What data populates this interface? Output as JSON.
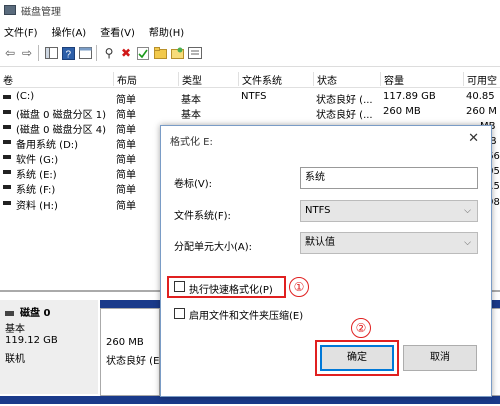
{
  "window": {
    "title": "磁盘管理"
  },
  "menu": [
    "文件(F)",
    "操作(A)",
    "查看(V)",
    "帮助(H)"
  ],
  "columns": [
    "卷",
    "布局",
    "类型",
    "文件系统",
    "状态",
    "容量",
    "可用空"
  ],
  "volumes": [
    {
      "name": "(C:)",
      "layout": "简单",
      "type": "基本",
      "fs": "NTFS",
      "status": "状态良好 (...",
      "capacity": "117.89 GB",
      "free": "40.85"
    },
    {
      "name": "(磁盘 0 磁盘分区 1)",
      "layout": "简单",
      "type": "基本",
      "fs": "",
      "status": "状态良好 (...",
      "capacity": "260 MB",
      "free": "260 M"
    },
    {
      "name": "(磁盘 0 磁盘分区 4)",
      "layout": "简单",
      "type": "",
      "fs": "",
      "status": "",
      "capacity": "",
      "free": "MB"
    },
    {
      "name": "备用系统 (D:)",
      "layout": "简单",
      "type": "",
      "fs": "",
      "status": "",
      "capacity": "",
      "free": "GB"
    },
    {
      "name": "软件 (G:)",
      "layout": "简单",
      "type": "",
      "fs": "",
      "status": "",
      "capacity": "",
      "free": ".66"
    },
    {
      "name": "系统 (E:)",
      "layout": "简单",
      "type": "",
      "fs": "",
      "status": "",
      "capacity": "",
      "free": ".05"
    },
    {
      "name": "系统 (F:)",
      "layout": "简单",
      "type": "",
      "fs": "",
      "status": "",
      "capacity": "",
      "free": "8.5"
    },
    {
      "name": "资料 (H:)",
      "layout": "简单",
      "type": "",
      "fs": "",
      "status": "",
      "capacity": "",
      "free": ".98"
    }
  ],
  "disk": {
    "name": "磁盘 0",
    "type": "基本",
    "size": "119.12 GB",
    "state": "联机"
  },
  "partition": {
    "size": "260 MB",
    "status": "状态良好 (E"
  },
  "dialog": {
    "title": "格式化 E:",
    "label_volume": "卷标(V):",
    "volume_value": "系统",
    "label_fs": "文件系统(F):",
    "fs_value": "NTFS",
    "label_alloc": "分配单元大小(A):",
    "alloc_value": "默认值",
    "quick_format": "执行快速格式化(P)",
    "quick_format_checked": false,
    "compression": "启用文件和文件夹压缩(E)",
    "compression_checked": false,
    "ok": "确定",
    "cancel": "取消"
  },
  "annotations": [
    "①",
    "②"
  ],
  "colors": {
    "accent": "#0078d7",
    "annotation": "#e02020",
    "partition_bar": "#1a3a8a"
  }
}
